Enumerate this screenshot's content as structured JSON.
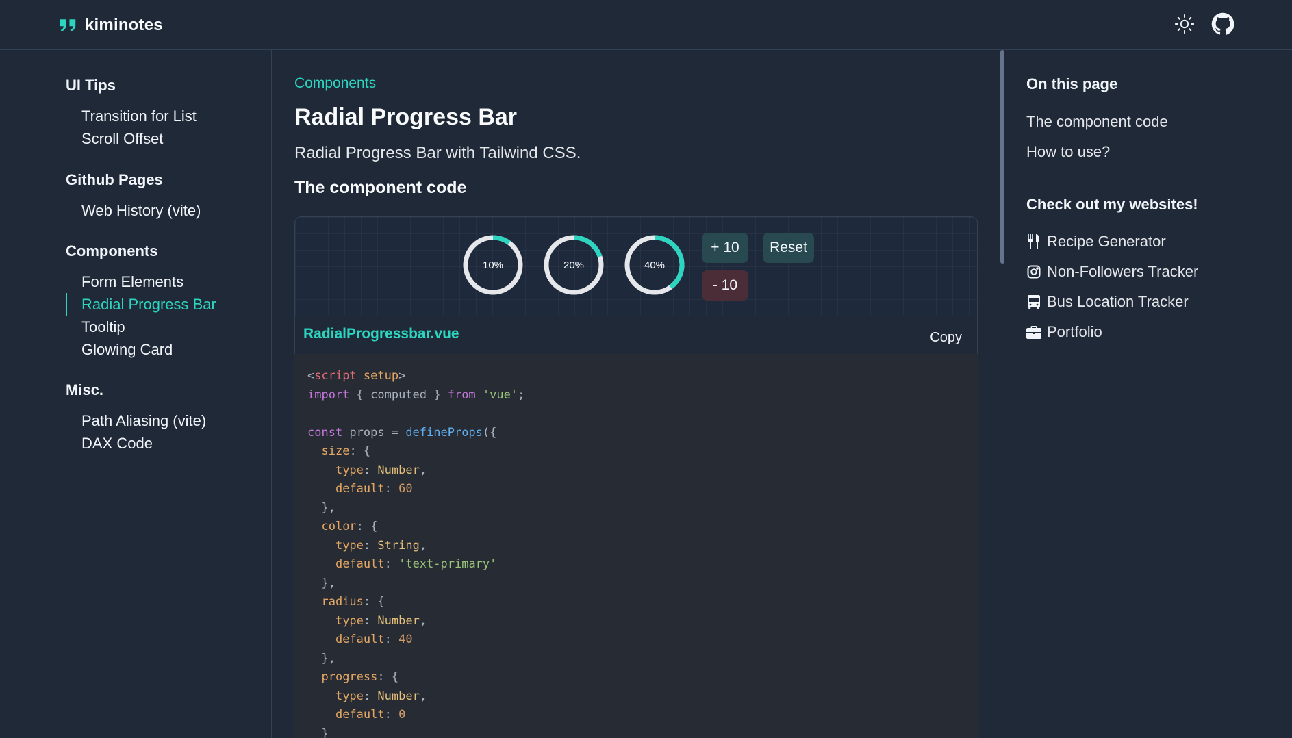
{
  "header": {
    "brand": "kiminotes",
    "icons": [
      "quote-logo-icon",
      "sun-icon",
      "github-icon"
    ]
  },
  "sidebar": {
    "groups": [
      {
        "title": "UI Tips",
        "items": [
          {
            "label": "Transition for List"
          },
          {
            "label": "Scroll Offset"
          }
        ]
      },
      {
        "title": "Github Pages",
        "items": [
          {
            "label": "Web History (vite)"
          }
        ]
      },
      {
        "title": "Components",
        "items": [
          {
            "label": "Form Elements"
          },
          {
            "label": "Radial Progress Bar",
            "active": true
          },
          {
            "label": "Tooltip"
          },
          {
            "label": "Glowing Card"
          }
        ]
      },
      {
        "title": "Misc.",
        "items": [
          {
            "label": "Path Aliasing (vite)"
          },
          {
            "label": "DAX Code"
          }
        ]
      }
    ]
  },
  "main": {
    "breadcrumb": "Components",
    "title": "Radial Progress Bar",
    "description": "Radial Progress Bar with Tailwind CSS.",
    "section_heading": "The component code",
    "demo": {
      "rings": [
        {
          "label": "10%",
          "progress": 0.1
        },
        {
          "label": "20%",
          "progress": 0.2
        },
        {
          "label": "40%",
          "progress": 0.4
        }
      ],
      "buttons": {
        "plus": "+ 10",
        "reset": "Reset",
        "minus": "- 10"
      },
      "accent_color": "#2dd4bf",
      "track_color": "#e5e7eb"
    },
    "file": {
      "name": "RadialProgressbar.vue",
      "copy_label": "Copy"
    },
    "code_lines": [
      [
        [
          "t-punc",
          "<"
        ],
        [
          "t-tag",
          "script"
        ],
        [
          "t-punc",
          " "
        ],
        [
          "t-prop",
          "setup"
        ],
        [
          "t-punc",
          ">"
        ]
      ],
      [
        [
          "t-kw",
          "import"
        ],
        [
          "t-punc",
          " { computed } "
        ],
        [
          "t-kw",
          "from"
        ],
        [
          "t-punc",
          " "
        ],
        [
          "t-str",
          "'vue'"
        ],
        [
          "t-punc",
          ";"
        ]
      ],
      [],
      [
        [
          "t-kw",
          "const"
        ],
        [
          "t-punc",
          " props = "
        ],
        [
          "t-fn",
          "defineProps"
        ],
        [
          "t-punc",
          "({"
        ]
      ],
      [
        [
          "t-punc",
          "  "
        ],
        [
          "t-prop",
          "size"
        ],
        [
          "t-punc",
          ": {"
        ]
      ],
      [
        [
          "t-punc",
          "    "
        ],
        [
          "t-prop",
          "type"
        ],
        [
          "t-punc",
          ": "
        ],
        [
          "t-type",
          "Number"
        ],
        [
          "t-punc",
          ","
        ]
      ],
      [
        [
          "t-punc",
          "    "
        ],
        [
          "t-prop",
          "default"
        ],
        [
          "t-punc",
          ": "
        ],
        [
          "t-num",
          "60"
        ]
      ],
      [
        [
          "t-punc",
          "  },"
        ]
      ],
      [
        [
          "t-punc",
          "  "
        ],
        [
          "t-prop",
          "color"
        ],
        [
          "t-punc",
          ": {"
        ]
      ],
      [
        [
          "t-punc",
          "    "
        ],
        [
          "t-prop",
          "type"
        ],
        [
          "t-punc",
          ": "
        ],
        [
          "t-type",
          "String"
        ],
        [
          "t-punc",
          ","
        ]
      ],
      [
        [
          "t-punc",
          "    "
        ],
        [
          "t-prop",
          "default"
        ],
        [
          "t-punc",
          ": "
        ],
        [
          "t-str",
          "'text-primary'"
        ]
      ],
      [
        [
          "t-punc",
          "  },"
        ]
      ],
      [
        [
          "t-punc",
          "  "
        ],
        [
          "t-prop",
          "radius"
        ],
        [
          "t-punc",
          ": {"
        ]
      ],
      [
        [
          "t-punc",
          "    "
        ],
        [
          "t-prop",
          "type"
        ],
        [
          "t-punc",
          ": "
        ],
        [
          "t-type",
          "Number"
        ],
        [
          "t-punc",
          ","
        ]
      ],
      [
        [
          "t-punc",
          "    "
        ],
        [
          "t-prop",
          "default"
        ],
        [
          "t-punc",
          ": "
        ],
        [
          "t-num",
          "40"
        ]
      ],
      [
        [
          "t-punc",
          "  },"
        ]
      ],
      [
        [
          "t-punc",
          "  "
        ],
        [
          "t-prop",
          "progress"
        ],
        [
          "t-punc",
          ": {"
        ]
      ],
      [
        [
          "t-punc",
          "    "
        ],
        [
          "t-prop",
          "type"
        ],
        [
          "t-punc",
          ": "
        ],
        [
          "t-type",
          "Number"
        ],
        [
          "t-punc",
          ","
        ]
      ],
      [
        [
          "t-punc",
          "    "
        ],
        [
          "t-prop",
          "default"
        ],
        [
          "t-punc",
          ": "
        ],
        [
          "t-num",
          "0"
        ]
      ],
      [
        [
          "t-punc",
          "  }"
        ]
      ]
    ]
  },
  "toc": {
    "title": "On this page",
    "links": [
      "The component code",
      "How to use?"
    ],
    "sites_title": "Check out my websites!",
    "sites": [
      {
        "label": "Recipe Generator",
        "icon": "utensils-icon"
      },
      {
        "label": "Non-Followers Tracker",
        "icon": "instagram-icon"
      },
      {
        "label": "Bus Location Tracker",
        "icon": "bus-icon"
      },
      {
        "label": "Portfolio",
        "icon": "briefcase-icon"
      }
    ]
  }
}
